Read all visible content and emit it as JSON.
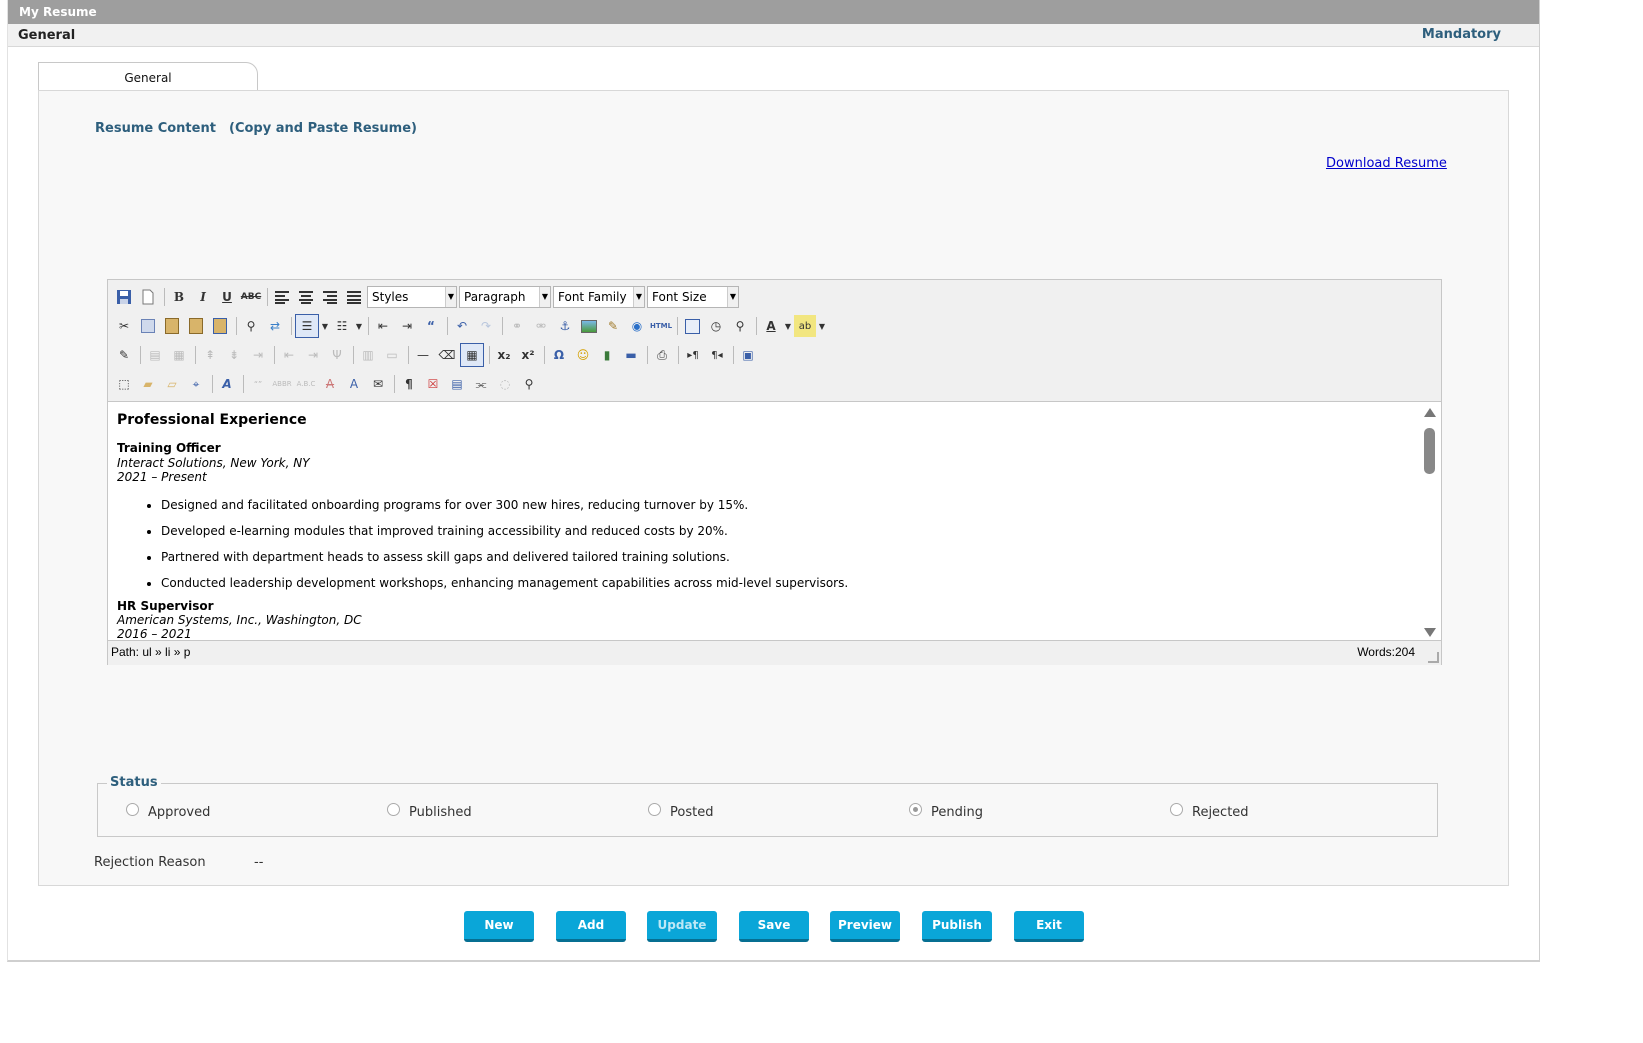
{
  "window": {
    "title": "My Resume"
  },
  "subheader": {
    "section": "General",
    "mandatory": "Mandatory"
  },
  "tab": {
    "label": "General"
  },
  "resume": {
    "content_label": "Resume Content",
    "paste_hint": "(Copy and Paste Resume)",
    "download_link": "Download Resume"
  },
  "editor": {
    "dropdowns": {
      "styles": "Styles",
      "format": "Paragraph",
      "font_family": "Font Family",
      "font_size": "Font Size"
    },
    "content": {
      "heading": "Professional Experience",
      "job1": {
        "title": "Training Officer",
        "company": "Interact Solutions, New York, NY",
        "dates": "2021 – Present",
        "bullets": [
          "Designed and facilitated onboarding programs for over 300 new hires, reducing turnover by 15%.",
          "Developed e-learning modules that improved training accessibility and reduced costs by 20%.",
          "Partnered with department heads to assess skill gaps and delivered tailored training solutions.",
          "Conducted leadership development workshops, enhancing management capabilities across mid-level supervisors."
        ]
      },
      "job2": {
        "title": "HR Supervisor",
        "company": "American Systems, Inc., Washington, DC",
        "dates": "2016 – 2021"
      }
    },
    "path": "Path: ul » li » p",
    "words": "Words:204"
  },
  "status": {
    "legend": "Status",
    "options": [
      "Approved",
      "Published",
      "Posted",
      "Pending",
      "Rejected"
    ],
    "selected": "Pending"
  },
  "rejection": {
    "label": "Rejection Reason",
    "value": "--"
  },
  "buttons": [
    "New",
    "Add",
    "Update",
    "Save",
    "Preview",
    "Publish",
    "Exit"
  ],
  "colors": {
    "accent_blue": "#2e5f7d",
    "button_blue": "#0aa6d8",
    "title_bar": "#9e9e9e"
  }
}
